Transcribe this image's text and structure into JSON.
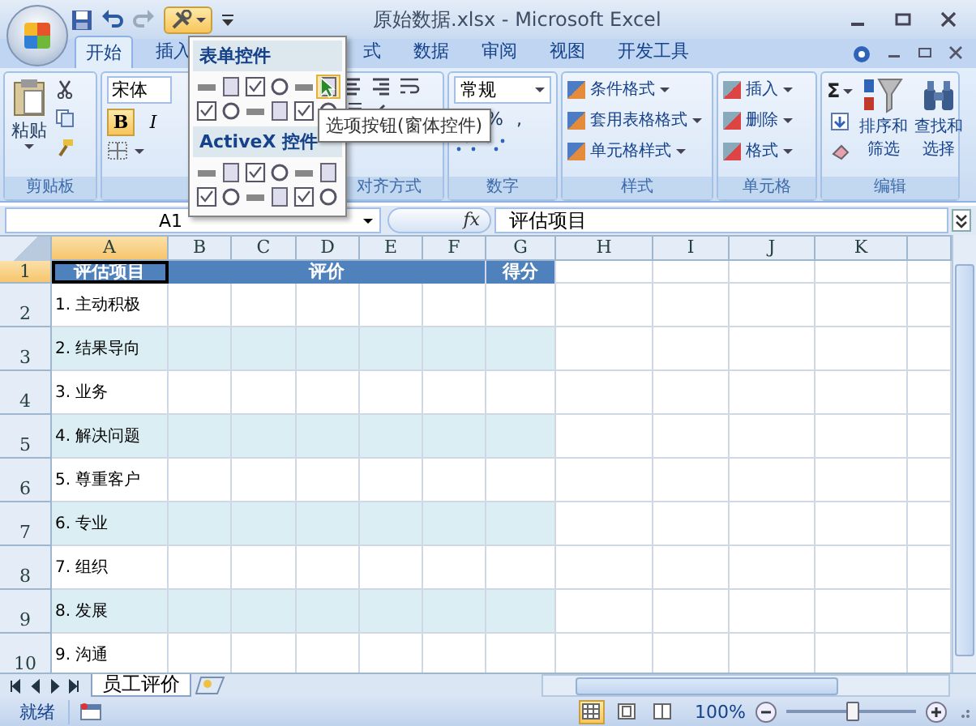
{
  "window": {
    "title": "原始数据.xlsx - Microsoft Excel"
  },
  "ribbon_tabs": [
    {
      "label": "开始",
      "selected": true
    },
    {
      "label": "插入",
      "selected": false
    },
    {
      "label": "式",
      "selected": false
    },
    {
      "label": "数据",
      "selected": false
    },
    {
      "label": "审阅",
      "selected": false
    },
    {
      "label": "视图",
      "selected": false
    },
    {
      "label": "开发工具",
      "selected": false
    }
  ],
  "clipboard": {
    "paste": "粘贴",
    "caption": "剪贴板"
  },
  "font": {
    "name": "宋体",
    "bold": "B",
    "italic": "I"
  },
  "alignment": {
    "caption": "对齐方式"
  },
  "number": {
    "format": "常规",
    "percent": "%",
    "comma": ",",
    "caption": "数字"
  },
  "styles": {
    "items": [
      "条件格式",
      "套用表格格式",
      "单元格样式"
    ],
    "caption": "样式"
  },
  "cells_group": {
    "items": [
      "插入",
      "删除",
      "格式"
    ],
    "caption": "单元格"
  },
  "editing": {
    "sum": "Σ",
    "sort": [
      "排序和",
      "筛选"
    ],
    "find": [
      "查找和",
      "选择"
    ],
    "caption": "编辑"
  },
  "controls_menu": {
    "sections": [
      "表单控件",
      "ActiveX 控件"
    ],
    "tooltip": "选项按钮(窗体控件)"
  },
  "formula_bar": {
    "name_box": "A1",
    "function_symbol": "fx",
    "content": "评估项目"
  },
  "sheet": {
    "columns": [
      {
        "label": "A",
        "selected": true
      },
      {
        "label": "B",
        "selected": false
      },
      {
        "label": "C",
        "selected": false
      },
      {
        "label": "D",
        "selected": false
      },
      {
        "label": "E",
        "selected": false
      },
      {
        "label": "F",
        "selected": false
      },
      {
        "label": "G",
        "selected": false
      },
      {
        "label": "H",
        "selected": false
      },
      {
        "label": "I",
        "selected": false
      },
      {
        "label": "J",
        "selected": false
      },
      {
        "label": "K",
        "selected": false
      }
    ],
    "header_row": {
      "number": "1",
      "selected": true,
      "item": "评估项目",
      "rating": "评价",
      "score": "得分"
    },
    "rows": [
      {
        "number": "2",
        "selected": false,
        "item": "1. 主动积极",
        "shaded": false
      },
      {
        "number": "3",
        "selected": false,
        "item": "2. 结果导向",
        "shaded": true
      },
      {
        "number": "4",
        "selected": false,
        "item": "3. 业务",
        "shaded": false
      },
      {
        "number": "5",
        "selected": false,
        "item": "4. 解决问题",
        "shaded": true
      },
      {
        "number": "6",
        "selected": false,
        "item": "5. 尊重客户",
        "shaded": false
      },
      {
        "number": "7",
        "selected": false,
        "item": "6. 专业",
        "shaded": true
      },
      {
        "number": "8",
        "selected": false,
        "item": "7. 组织",
        "shaded": false
      },
      {
        "number": "9",
        "selected": false,
        "item": "8. 发展",
        "shaded": true
      },
      {
        "number": "10",
        "selected": false,
        "item": "9. 沟通",
        "shaded": false
      }
    ]
  },
  "sheet_tabs": [
    {
      "label": "员工评价",
      "selected": true
    }
  ],
  "status_bar": {
    "status": "就绪",
    "views": [
      {
        "selected": true
      },
      {
        "selected": false
      },
      {
        "selected": false
      }
    ],
    "zoom": {
      "reading": "100%",
      "level": 0.5
    }
  }
}
